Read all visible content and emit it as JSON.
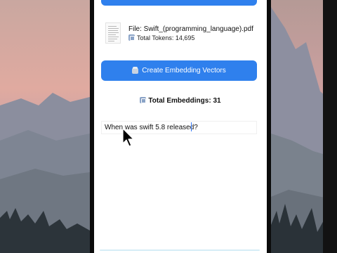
{
  "document": {
    "file_label": "File: Swift_(programming_language).pdf",
    "tokens_label": "Total Tokens: 14,695"
  },
  "actions": {
    "create_embeddings_label": "Create Embedding Vectors"
  },
  "stats": {
    "total_embeddings_label": "Total Embeddings: 31"
  },
  "query": {
    "value": "When was swift 5.8 released?"
  },
  "colors": {
    "accent": "#2f80ed",
    "sky_top": "#d9a79a",
    "mountain": "#8a8f9a",
    "forest": "#2a3238"
  },
  "icons": [
    "document-thumbnail-icon",
    "numbers-icon",
    "package-icon",
    "mouse-pointer-icon"
  ]
}
